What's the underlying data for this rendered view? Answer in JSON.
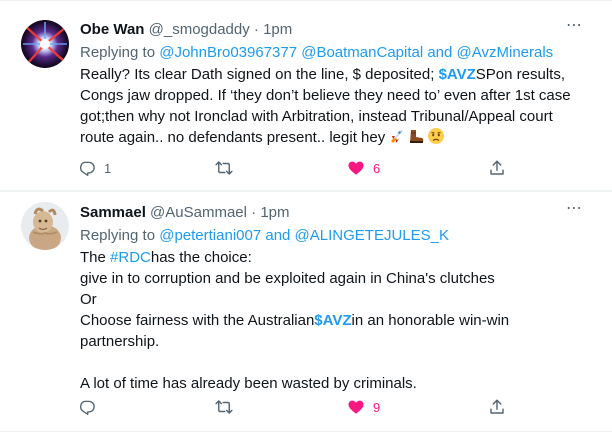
{
  "tweets": [
    {
      "author": {
        "name": "Obe Wan",
        "handle": "@_smogdaddy",
        "time": "1pm"
      },
      "more_icon": "⋯",
      "reply": {
        "prefix": "Replying to",
        "mentions": "@JohnBro03967377 @BoatmanCapital and @AvzMinerals"
      },
      "body": {
        "l1_pre": "Really? Its clear Dath signed on the line, $ deposited; ",
        "l1_cash": "$AVZ",
        "l1_post": "SPon results,",
        "l2": "Congs jaw dropped. If ‘they don’t believe they need to’ even after 1st case",
        "l3": "got;then why not Ironclad with Arbitration, instead Tribunal/Appeal court",
        "l4": "route again.. no defendants present.. legit hey",
        "emojis": [
          "rocket-emoji",
          "boot-emoji",
          "worried-face-emoji"
        ]
      },
      "actions": {
        "reply_count": "1",
        "retweet_count": "",
        "like_count": "6",
        "liked": true
      }
    },
    {
      "author": {
        "name": "Sammael",
        "handle": "@AuSammael",
        "time": "1pm"
      },
      "more_icon": "⋯",
      "reply": {
        "prefix": "Replying to",
        "mentions": "@petertiani007 and @ALINGETEJULES_K"
      },
      "body": {
        "l1_pre": "The ",
        "l1_tag": "#RDC",
        "l1_post": "has the choice:",
        "l2": "give in to corruption and be exploited again in China's clutches",
        "l3": "Or",
        "l4_pre": "Choose fairness with the Australian",
        "l4_cash": "$AVZ",
        "l4_post": "in an honorable win-win",
        "l5": "partnership.",
        "l6": "A lot of time has already been wasted by criminals."
      },
      "actions": {
        "reply_count": "",
        "retweet_count": "",
        "like_count": "9",
        "liked": true
      }
    }
  ],
  "colors": {
    "accent": "#1d9bf0",
    "like": "#f91880",
    "muted": "#536471",
    "text": "#0f1419",
    "border": "#eff3f4"
  },
  "icons": [
    "reply-icon",
    "retweet-icon",
    "like-icon",
    "share-icon",
    "more-icon"
  ]
}
